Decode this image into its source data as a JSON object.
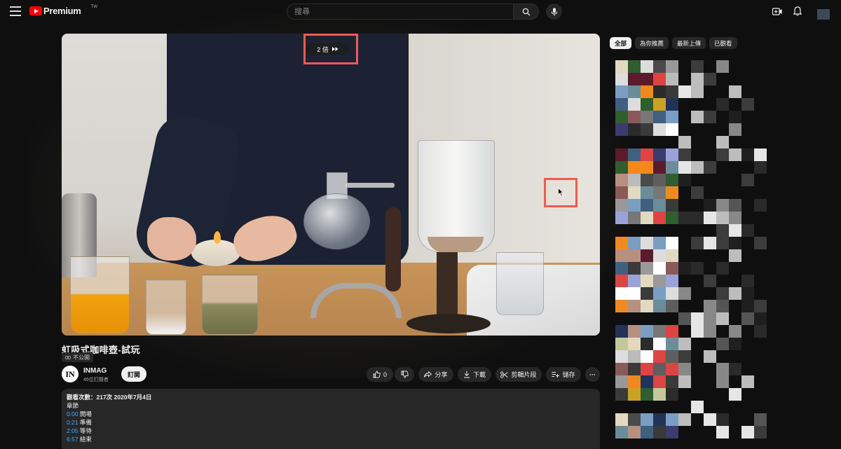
{
  "header": {
    "brand": "Premium",
    "brand_region": "TW",
    "search_placeholder": "搜尋",
    "icons": [
      "menu-icon",
      "search-icon",
      "mic-icon",
      "create-video-icon",
      "bell-icon"
    ]
  },
  "player": {
    "speed_label": "2 倍",
    "speed_icon": "fast-forward-icon",
    "highlight_color": "#ef5b52"
  },
  "video": {
    "title": "虹吸式咖啡壺-試玩",
    "privacy": "不公開",
    "channel_initial": "IN",
    "channel_name": "INMAG",
    "subscribers": "46位訂閱者",
    "subscribe_label": "訂閱",
    "like_count": "0",
    "share_label": "分享",
    "download_label": "下載",
    "clip_label": "剪輯片段",
    "save_label": "儲存",
    "more_label": "···"
  },
  "description": {
    "stats": "觀看次數：217次  2020年7月4日",
    "chapters_heading": "章節",
    "chapters": [
      {
        "time": "0:00",
        "label": "開場"
      },
      {
        "time": "0:21",
        "label": "準備"
      },
      {
        "time": "2:05",
        "label": "等待"
      },
      {
        "time": "6:57",
        "label": "結束"
      }
    ]
  },
  "sidebar": {
    "chips": [
      "全部",
      "為你推薦",
      "最新上傳",
      "已觀看"
    ],
    "active_chip": "全部"
  },
  "colors": {
    "background": "#0f0f0f",
    "accent_red": "#ff0000",
    "link_blue": "#3ea6ff"
  }
}
